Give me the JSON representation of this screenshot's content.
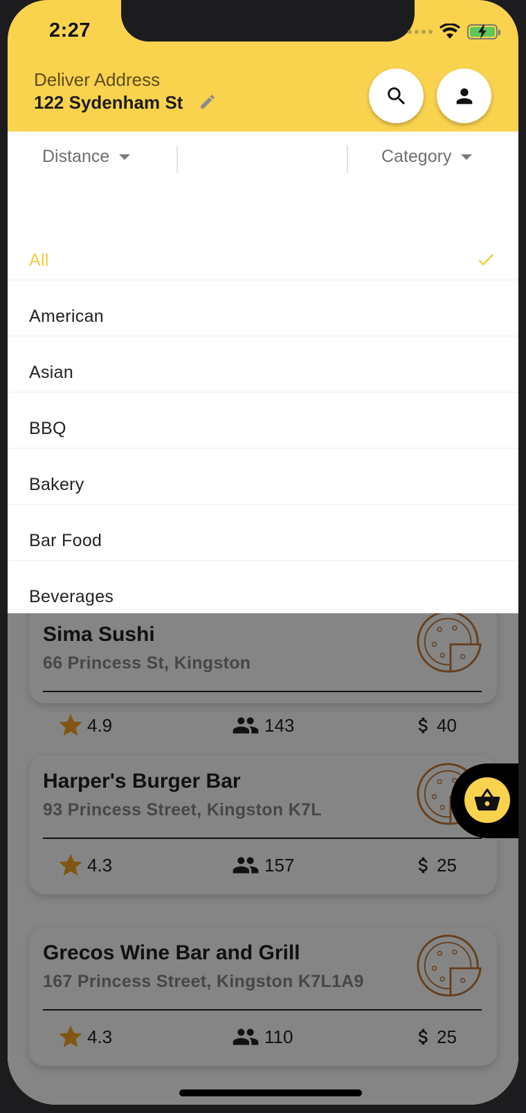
{
  "status_bar": {
    "time": "2:27"
  },
  "header": {
    "address_label": "Deliver Address",
    "address_value": "122 Sydenham St",
    "brand_color": "#f9d24e"
  },
  "filters": {
    "distance_label": "Distance",
    "category_label": "Category"
  },
  "dropdown": {
    "selected_color": "#f4cc45",
    "items": [
      {
        "label": "All",
        "selected": true
      },
      {
        "label": "American",
        "selected": false
      },
      {
        "label": "Asian",
        "selected": false
      },
      {
        "label": "BBQ",
        "selected": false
      },
      {
        "label": "Bakery",
        "selected": false
      },
      {
        "label": "Bar Food",
        "selected": false
      },
      {
        "label": "Beverages",
        "selected": false
      }
    ]
  },
  "restaurants": [
    {
      "name": "Sima Sushi",
      "address": "66 Princess St, Kingston",
      "rating": "4.9",
      "reviews": "143",
      "price": "40"
    },
    {
      "name": "Harper's Burger Bar",
      "address": "93 Princess Street, Kingston K7L",
      "rating": "4.3",
      "reviews": "157",
      "price": "25"
    },
    {
      "name": "Grecos Wine Bar and Grill",
      "address": "167 Princess Street, Kingston K7L1A9",
      "rating": "4.3",
      "reviews": "110",
      "price": "25"
    }
  ],
  "icons": {
    "search": "search-icon",
    "profile": "person-icon",
    "edit": "pencil-icon",
    "cart": "basket-icon",
    "check": "check-icon",
    "star": "star-icon",
    "people": "people-icon",
    "dollar": "dollar-icon",
    "pizza": "pizza-icon"
  }
}
